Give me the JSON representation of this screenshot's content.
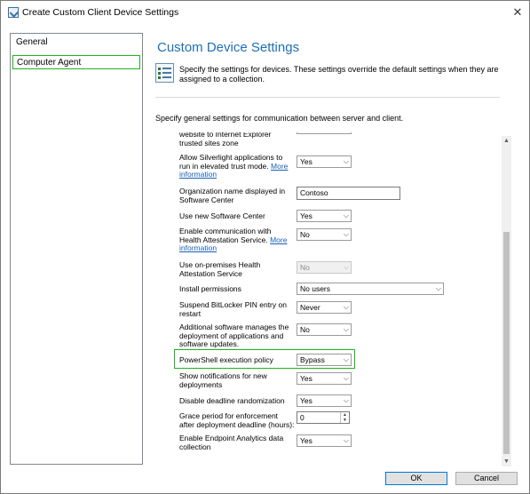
{
  "window": {
    "title": "Create Custom Client Device Settings",
    "close_glyph": "✕"
  },
  "nav": {
    "items": [
      {
        "label": "General"
      },
      {
        "label": "Computer Agent"
      }
    ]
  },
  "page": {
    "title": "Custom Device Settings",
    "description": "Specify the settings for devices. These settings override the default settings when they are assigned to a collection.",
    "general_text": "Specify general settings for communication between server and client."
  },
  "settings": {
    "partial_top_label": "website to Internet Explorer trusted sites zone",
    "silverlight": {
      "label": "Allow Silverlight applications to run in elevated trust mode.",
      "link": "More information",
      "value": "Yes"
    },
    "org_name": {
      "label": "Organization name displayed in Software Center",
      "value": "Contoso"
    },
    "new_sc": {
      "label": "Use new Software Center",
      "value": "Yes"
    },
    "health_attestation": {
      "label": "Enable communication with Health Attestation Service.",
      "link": "More information",
      "value": "No"
    },
    "onprem_ha": {
      "label": "Use on-premises Health Attestation Service",
      "value": "No"
    },
    "install_perm": {
      "label": "Install permissions",
      "value": "No users"
    },
    "bitlocker": {
      "label": "Suspend BitLocker PIN entry on restart",
      "value": "Never"
    },
    "additional_sw": {
      "label": "Additional software manages the deployment of applications and software updates.",
      "value": "No"
    },
    "powershell": {
      "label": "PowerShell execution policy",
      "value": "Bypass"
    },
    "notifications": {
      "label": "Show notifications for new deployments",
      "value": "Yes"
    },
    "deadline_rand": {
      "label": "Disable deadline randomization",
      "value": "Yes"
    },
    "grace_period": {
      "label": "Grace period for enforcement after deployment deadline (hours):",
      "value": "0"
    },
    "endpoint_analytics": {
      "label": "Enable Endpoint Analytics data collection",
      "value": "Yes"
    }
  },
  "icons": {
    "dropdown": "⌵",
    "scroll_up": "▲",
    "scroll_down": "▼",
    "spin_up": "▲",
    "spin_down": "▼"
  },
  "buttons": {
    "ok": "OK",
    "cancel": "Cancel"
  },
  "colors": {
    "title_blue": "#1f6fb4",
    "highlight_green": "#1bb51b",
    "link_blue": "#1a5fb4"
  }
}
